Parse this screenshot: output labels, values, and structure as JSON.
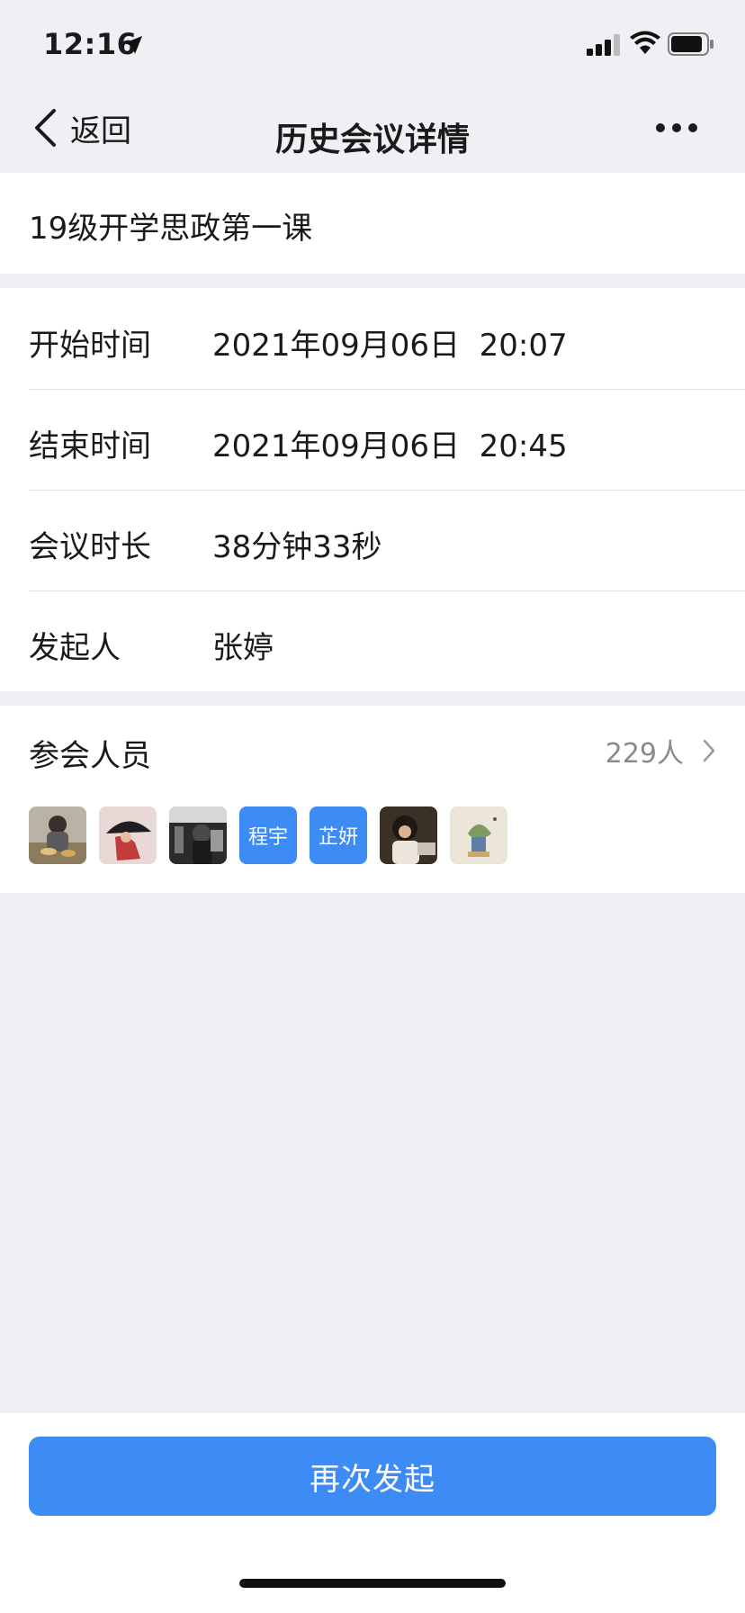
{
  "status_bar": {
    "time": "12:16",
    "icons": [
      "location-arrow-icon",
      "cellular-signal-icon",
      "wifi-icon",
      "battery-icon"
    ]
  },
  "nav": {
    "back_label": "返回",
    "title": "历史会议详情",
    "more_icon": "more-dots-icon"
  },
  "meeting": {
    "name": "19级开学思政第一课"
  },
  "details": [
    {
      "label": "开始时间",
      "value": "2021年09月06日  20:07"
    },
    {
      "label": "结束时间",
      "value": "2021年09月06日  20:45"
    },
    {
      "label": "会议时长",
      "value": "38分钟33秒"
    },
    {
      "label": "发起人",
      "value": "张婷"
    }
  ],
  "attendees": {
    "label": "参会人员",
    "count": "229人",
    "avatars": [
      {
        "type": "photo",
        "icon": "avatar-photo-1"
      },
      {
        "type": "photo",
        "icon": "avatar-photo-2"
      },
      {
        "type": "photo",
        "icon": "avatar-photo-3"
      },
      {
        "type": "text",
        "text": "程宇"
      },
      {
        "type": "text",
        "text": "芷妍"
      },
      {
        "type": "photo",
        "icon": "avatar-photo-4"
      },
      {
        "type": "photo",
        "icon": "avatar-photo-5"
      }
    ]
  },
  "action": {
    "label": "再次发起"
  },
  "colors": {
    "accent": "#3d8bf5",
    "background": "#efeff4",
    "muted": "#8a8a8a"
  }
}
